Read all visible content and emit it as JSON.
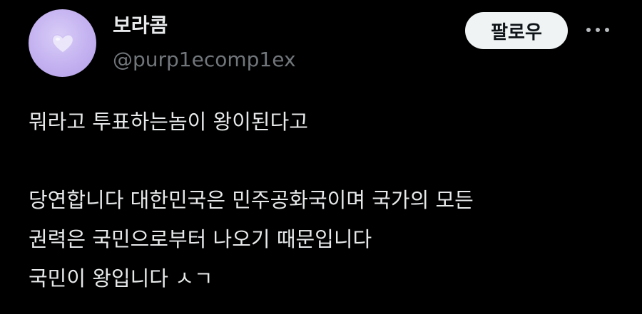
{
  "profile": {
    "display_name": "보라콤",
    "handle": "@purp1ecomp1ex",
    "avatar_icon": "heart-icon",
    "avatar_color": "#c3b1f0"
  },
  "actions": {
    "follow_label": "팔로우",
    "more_icon": "more-horizontal-icon"
  },
  "tweet": {
    "lines": [
      "뭐라고 투표하는놈이 왕이된다고",
      "",
      "당연합니다 대한민국은 민주공화국이며 국가의 모든",
      "권력은 국민으로부터 나오기 때문입니다",
      "국민이 왕입니다 ㅅㄱ"
    ]
  },
  "colors": {
    "background": "#000000",
    "text_primary": "#e7e9ea",
    "text_secondary": "#71767b",
    "button_bg": "#eff3f4",
    "button_text": "#0f1419"
  }
}
